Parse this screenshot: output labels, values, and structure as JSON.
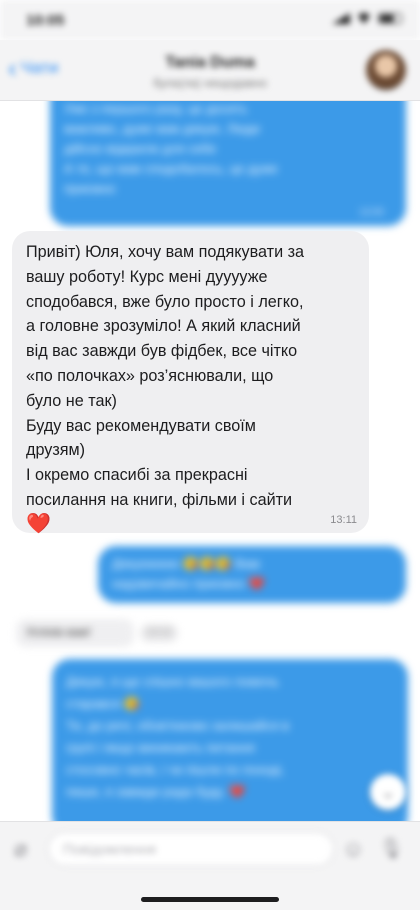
{
  "status_bar": {
    "time": "10:05"
  },
  "header": {
    "back_label": "Чати",
    "contact_name": "Tania Duma",
    "contact_status": "була(ла) нещодавно"
  },
  "messages": {
    "outgoing_top": {
      "lines": [
        "Уже з першого разу, це досить",
        "важливо, дуже вам дякую. Люди",
        "дійсно відкрили для себе",
        "А те, що вам сподобалось, це дуже",
        "приємно"
      ],
      "time": "13:05"
    },
    "incoming_main": {
      "lines": [
        "Привіт) Юля, хочу вам подякувати за",
        "вашу роботу! Курс мені дууууже",
        "сподобався, вже було просто і легко,",
        "а головне зрозуміло! А який класний",
        "від вас завжди був фідбек, все чітко",
        "«по полочках» роз’яснювали, що",
        "було не так)",
        "Буду вас рекомендувати своїм",
        "друзям)",
        "І окремо спасибі за прекрасні",
        "посилання на книги, фільми і сайти"
      ],
      "heart": "❤️",
      "time": "13:11"
    },
    "outgoing_thanks": {
      "lines": [
        "Дякуюююю 😘😘😘 Вам",
        "надзвичайно приємно ❤️"
      ]
    },
    "incoming_short": {
      "text": "Успіхів вам!",
      "time": "13:12"
    },
    "outgoing_bottom": {
      "lines": [
        "Дякую, я ще спішно вашого помочь",
        "старався 😘",
        "Ти, до речі, обов'язково залишайся в",
        "групі і якщо виникають питання",
        "стосовно часів, і чи пішли по поході,",
        "пиши, я завжди рада буду. ❤️"
      ]
    }
  },
  "input": {
    "placeholder": "Повідомлення"
  },
  "icons": {
    "back": "chevron-left-icon",
    "attach": "paperclip-icon",
    "sticker": "sticker-icon",
    "mic": "microphone-icon",
    "scroll": "chevron-down-icon"
  },
  "colors": {
    "outgoing_bubble": "#3c9ae8",
    "incoming_bubble": "#efeff1",
    "accent": "#2f8ef5",
    "heart": "#e5252c"
  }
}
